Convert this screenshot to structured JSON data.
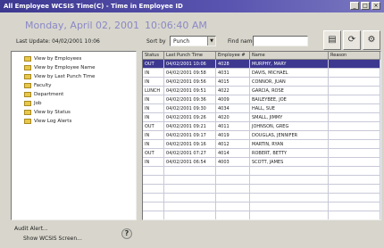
{
  "window": {
    "title": "All Employee WCSIS Time(C) - Time in Employee ID",
    "min_glyph": "_",
    "max_glyph": "□",
    "close_glyph": "×"
  },
  "header": {
    "date_text": "Monday, April 02, 2001",
    "time_text": "10:06:40 AM",
    "last_update": "Last Update: 04/02/2001 10:06"
  },
  "sort_by": {
    "label": "Sort by",
    "value": "Punch",
    "arrow": "▼"
  },
  "find_name": {
    "label": "Find name",
    "value": ""
  },
  "toolbar": {
    "print_glyph": "▤",
    "refresh_glyph": "⟳",
    "extra_glyph": "⚙"
  },
  "tree": {
    "items": [
      {
        "label": "View by Employees"
      },
      {
        "label": "View by Employee Name"
      },
      {
        "label": "View by Last Punch Time"
      },
      {
        "label": "Faculty"
      },
      {
        "label": "Department"
      },
      {
        "label": "Job"
      },
      {
        "label": "View by Status"
      },
      {
        "label": "View Log Alerts"
      }
    ]
  },
  "grid": {
    "columns": [
      "Status",
      "Last Punch Time",
      "Employee #",
      "Name",
      "Reason"
    ],
    "rows": [
      [
        "OUT",
        "04/02/2001 10:06",
        "4028",
        "MURPHY, MARY",
        ""
      ],
      [
        "IN",
        "04/02/2001 09:58",
        "4031",
        "DAVIS, MICHAEL",
        ""
      ],
      [
        "IN",
        "04/02/2001 09:56",
        "4015",
        "CONNOR, JUAN",
        ""
      ],
      [
        "LUNCH",
        "04/02/2001 09:51",
        "4022",
        "GARCIA, ROSE",
        ""
      ],
      [
        "IN",
        "04/02/2001 09:36",
        "4009",
        "BAILEYBEE, JOE",
        ""
      ],
      [
        "IN",
        "04/02/2001 09:30",
        "4034",
        "HALL, SUE",
        ""
      ],
      [
        "IN",
        "04/02/2001 09:26",
        "4020",
        "SMALL, JIMMY",
        ""
      ],
      [
        "OUT",
        "04/02/2001 09:21",
        "4011",
        "JOHNSON, GREG",
        ""
      ],
      [
        "IN",
        "04/02/2001 09:17",
        "4019",
        "DOUGLAS, JENNIFER",
        ""
      ],
      [
        "IN",
        "04/02/2001 09:16",
        "4012",
        "MARTIN, RYAN",
        ""
      ],
      [
        "OUT",
        "04/02/2001 07:27",
        "4014",
        "ROBERT, BETTY",
        ""
      ],
      [
        "IN",
        "04/02/2001 06:54",
        "4003",
        "SCOTT, JAMES",
        ""
      ]
    ]
  },
  "bottom": {
    "link1": "Audit Alert...",
    "link2": "Show WCSIS Screen...",
    "help_glyph": "?"
  }
}
